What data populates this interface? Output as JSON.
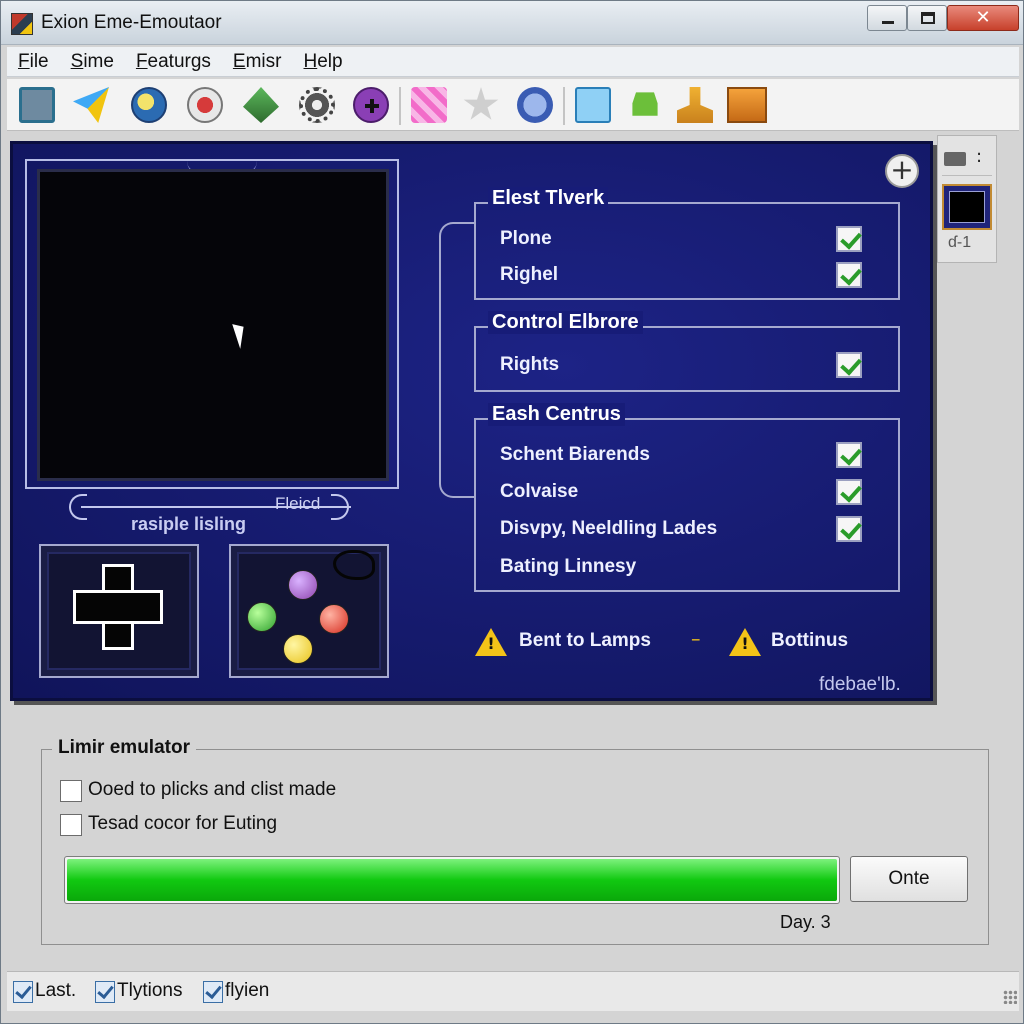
{
  "window": {
    "title": "Exion Eme-Emoutaor",
    "close_glyph": "✕"
  },
  "menu": {
    "items": [
      {
        "label": "File"
      },
      {
        "label": "Sime"
      },
      {
        "label": "Featurgs"
      },
      {
        "label": "Emisr"
      },
      {
        "label": "Help"
      }
    ]
  },
  "toolbar": {
    "icons": [
      "monitor-icon",
      "bird-icon",
      "globe-icon",
      "record-icon",
      "plate-icon",
      "gear-icon",
      "gamepad-icon",
      "gift-icon",
      "star-icon",
      "bug-icon",
      "document-icon",
      "android-icon",
      "stamp-icon",
      "crate-icon"
    ]
  },
  "emulator": {
    "slider_tag": "Fleicd",
    "screen_caption": "rasiple lisling",
    "add_symbol": "+"
  },
  "groups": {
    "group1": {
      "title": "Elest Tlverk",
      "options": [
        {
          "label": "Plone",
          "checked": true
        },
        {
          "label": "Righel",
          "checked": true
        }
      ]
    },
    "group2": {
      "title": "Control Elbrore",
      "options": [
        {
          "label": "Rights",
          "checked": true
        }
      ]
    },
    "group3": {
      "title": "Eash Centrus",
      "options": [
        {
          "label": "Schent Biarends",
          "checked": true
        },
        {
          "label": "Colvaise",
          "checked": true
        },
        {
          "label": "Disvpy, Neeldling Lades",
          "checked": true
        },
        {
          "label": "Bating Linnesy",
          "checked": false
        }
      ]
    }
  },
  "warnings": {
    "left_label": "Bent to Lamps",
    "separator": "–",
    "right_label": "Bottinus",
    "mark": "!"
  },
  "panel_tag": "fdebae'lb.",
  "side_strip": {
    "label": "ɗ-1",
    "menu_dots": ":"
  },
  "limit": {
    "title": "Limir emulator",
    "option1": "Ooed to plicks and clist made",
    "option2": "Tesad cocor for Euting",
    "progress_fraction": 1.0,
    "button_label": "Onte",
    "day_text": "Day. 3"
  },
  "statusbar": {
    "items": [
      {
        "label": "Last."
      },
      {
        "label": "Tlytions"
      },
      {
        "label": "flyien"
      }
    ]
  },
  "colors": {
    "panel_blue": "#171c78",
    "progress_green": "#11c911",
    "checkmark_green": "#2a9c2a",
    "warning_yellow": "#f3c318"
  }
}
